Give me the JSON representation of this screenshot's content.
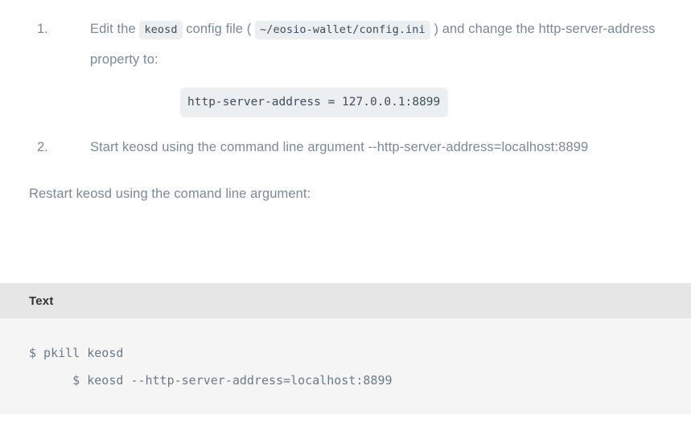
{
  "document": {
    "steps": [
      {
        "marker": "1.",
        "text_part_1": "Edit the ",
        "inline_code_1": "keosd",
        "text_part_2": " config file ( ",
        "inline_code_2": "~/eosio-wallet/config.ini",
        "text_part_3": " ) and change the http-server-address property to:",
        "code_block": "http-server-address = 127.0.0.1:8899"
      },
      {
        "marker": "2.",
        "text": "Start keosd using the command line argument --http-server-address=localhost:8899"
      }
    ],
    "paragraph": "Restart keosd using the comand line argument:"
  },
  "code_panel": {
    "title": "Text",
    "lines": [
      "$ pkill keosd",
      "      $ keosd --http-server-address=localhost:8899"
    ],
    "content": "$ pkill keosd\n      $ keosd --http-server-address=localhost:8899"
  },
  "colors": {
    "page_background": "#ffffff",
    "body_text": "#7b8a97",
    "inline_code_background": "#eceff1",
    "inline_code_text": "#3e4d5c",
    "panel_header_background": "#e6e6e6",
    "panel_header_text": "#333333",
    "panel_body_background": "#f5f5f5",
    "panel_body_text": "#6a7a8a"
  }
}
